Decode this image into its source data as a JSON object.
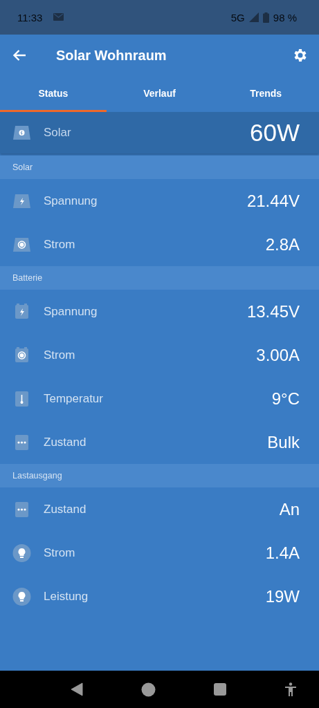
{
  "status_bar": {
    "time": "11:33",
    "network": "5G",
    "battery": "98 %"
  },
  "app_bar": {
    "title": "Solar Wohnraum"
  },
  "tabs": [
    {
      "label": "Status",
      "selected": true
    },
    {
      "label": "Verlauf",
      "selected": false
    },
    {
      "label": "Trends",
      "selected": false
    }
  ],
  "summary": {
    "kind": "panel-dot",
    "label": "Solar",
    "value": "60W"
  },
  "sections": [
    {
      "title": "Solar",
      "rows": [
        {
          "kind": "panel-bolt",
          "label": "Spannung",
          "value": "21.44V"
        },
        {
          "kind": "panel-circle",
          "label": "Strom",
          "value": "2.8A"
        }
      ]
    },
    {
      "title": "Batterie",
      "rows": [
        {
          "kind": "battery-bolt",
          "label": "Spannung",
          "value": "13.45V"
        },
        {
          "kind": "battery-circle",
          "label": "Strom",
          "value": "3.00A"
        },
        {
          "kind": "thermometer",
          "label": "Temperatur",
          "value": "9°C"
        },
        {
          "kind": "dots",
          "label": "Zustand",
          "value": "Bulk"
        }
      ]
    },
    {
      "title": "Lastausgang",
      "rows": [
        {
          "kind": "dots",
          "label": "Zustand",
          "value": "An"
        },
        {
          "kind": "bulb",
          "label": "Strom",
          "value": "1.4A"
        },
        {
          "kind": "bulb",
          "label": "Leistung",
          "value": "19W"
        }
      ]
    }
  ]
}
